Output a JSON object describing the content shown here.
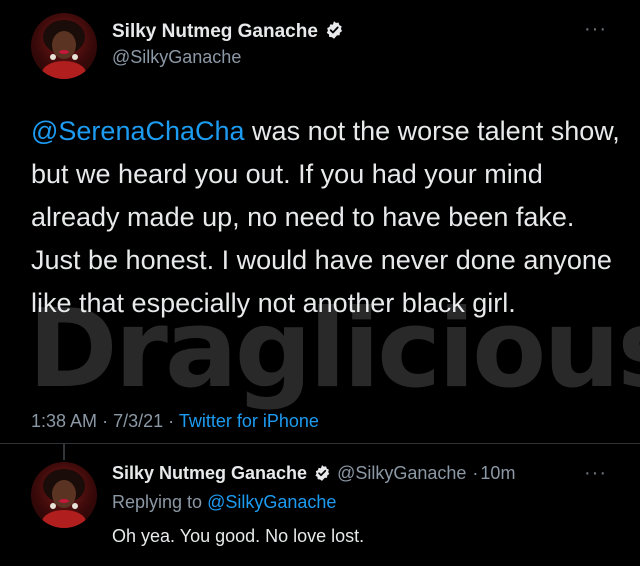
{
  "colors": {
    "background": "#000000",
    "text": "#e7e9ea",
    "secondary_text": "#8b98a5",
    "link": "#1d9bf0",
    "verified_badge": "#e7e9ea",
    "divider": "#2f3336"
  },
  "main_tweet": {
    "author": {
      "display_name": "Silky Nutmeg Ganache",
      "handle": "@SilkyGanache",
      "verified": true,
      "avatar_icon": "profile-photo"
    },
    "more_icon": "more-horizontal-icon",
    "more_glyph": "···",
    "text": {
      "mention": "@SerenaChaCha",
      "body": " was not the worse talent show, but we heard you out. If you had your mind already made up, no need to have been fake. Just be honest. I would have never done anyone like that especially not another black girl."
    },
    "time": "1:38 AM",
    "date": "7/3/21",
    "separator": "·",
    "source": "Twitter for iPhone"
  },
  "watermark": {
    "text": "Draglicious"
  },
  "reply_tweet": {
    "author": {
      "display_name": "Silky Nutmeg Ganache",
      "handle": "@SilkyGanache",
      "verified": true,
      "avatar_icon": "profile-photo"
    },
    "time_ago": "10m",
    "separator": "·",
    "more_glyph": "···",
    "replying_to_label": "Replying to",
    "replying_to_handle": "@SilkyGanache",
    "text": "Oh yea. You good. No love lost."
  }
}
